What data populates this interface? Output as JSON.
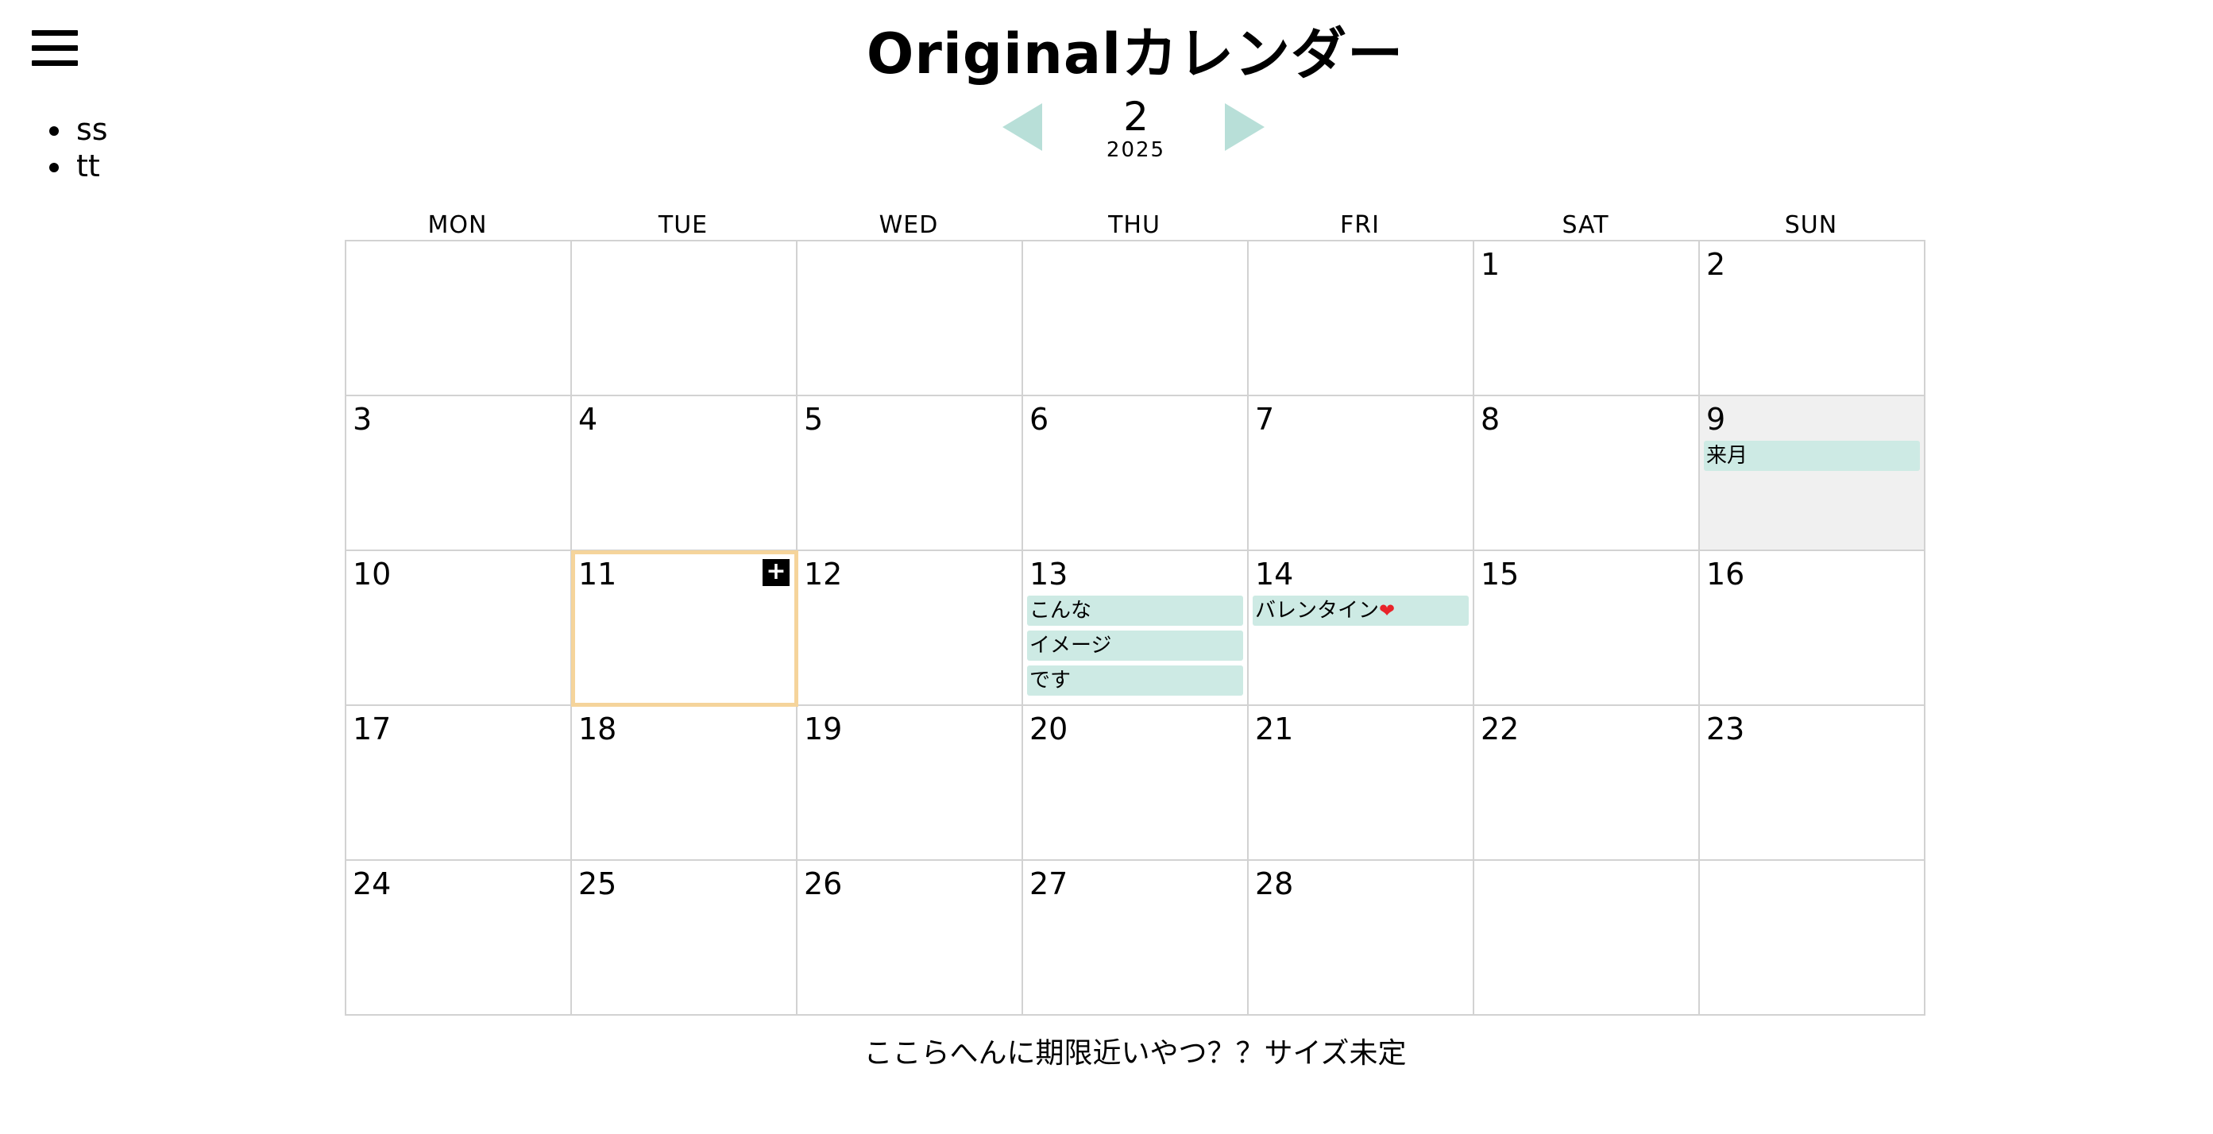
{
  "app": {
    "title": "Originalカレンダー"
  },
  "menu": {
    "icon": "hamburger-menu-icon"
  },
  "sidebar": {
    "items": [
      {
        "label": "ss"
      },
      {
        "label": "tt"
      }
    ]
  },
  "nav": {
    "month": "2",
    "year": "2025",
    "prev_icon": "triangle-left-icon",
    "next_icon": "triangle-right-icon",
    "arrow_color": "#b8dfd8"
  },
  "calendar": {
    "weekdays": [
      "MON",
      "TUE",
      "WED",
      "THU",
      "FRI",
      "SAT",
      "SUN"
    ],
    "selected_day": "11",
    "shaded_day": "9",
    "add_button_label": "+",
    "colors": {
      "event_bg": "#cdeae4",
      "selected_outline": "#f5d49b",
      "shaded_bg": "#f0f0f0"
    },
    "weeks": [
      [
        {
          "day": ""
        },
        {
          "day": ""
        },
        {
          "day": ""
        },
        {
          "day": ""
        },
        {
          "day": ""
        },
        {
          "day": "1"
        },
        {
          "day": "2"
        }
      ],
      [
        {
          "day": "3"
        },
        {
          "day": "4"
        },
        {
          "day": "5"
        },
        {
          "day": "6"
        },
        {
          "day": "7"
        },
        {
          "day": "8"
        },
        {
          "day": "9",
          "events": [
            "来月"
          ]
        }
      ],
      [
        {
          "day": "10"
        },
        {
          "day": "11"
        },
        {
          "day": "12"
        },
        {
          "day": "13",
          "events": [
            "こんな",
            "イメージ",
            "です"
          ]
        },
        {
          "day": "14",
          "events": [
            "バレンタイン"
          ]
        },
        {
          "day": "15"
        },
        {
          "day": "16"
        }
      ],
      [
        {
          "day": "17"
        },
        {
          "day": "18"
        },
        {
          "day": "19"
        },
        {
          "day": "20"
        },
        {
          "day": "21"
        },
        {
          "day": "22"
        },
        {
          "day": "23"
        }
      ],
      [
        {
          "day": "24"
        },
        {
          "day": "25"
        },
        {
          "day": "26"
        },
        {
          "day": "27"
        },
        {
          "day": "28"
        },
        {
          "day": ""
        },
        {
          "day": ""
        }
      ]
    ]
  },
  "footer": {
    "note": "ここらへんに期限近いやつ？？サイズ未定"
  }
}
